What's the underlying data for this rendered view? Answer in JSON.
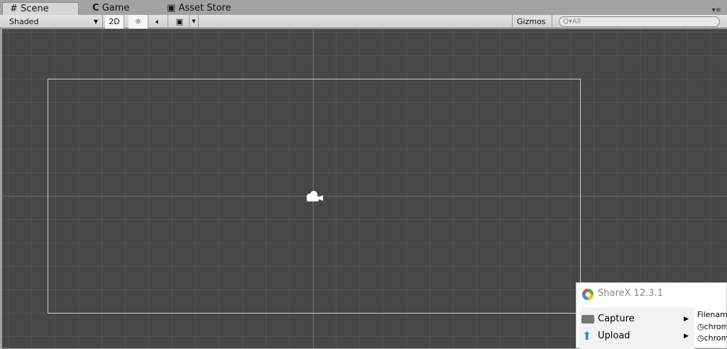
{
  "tabs": [
    {
      "label": "Scene",
      "icon": "grid-icon"
    },
    {
      "label": "Game",
      "icon": "pacman-icon"
    },
    {
      "label": "Asset Store",
      "icon": "bag-icon"
    }
  ],
  "toolbar": {
    "shading": "Shaded",
    "mode_2d": "2D",
    "gizmos": "Gizmos",
    "search_placeholder": "All"
  },
  "sharex": {
    "title": "ShareX 12.3.1",
    "menu": [
      {
        "label": "Capture"
      },
      {
        "label": "Upload"
      }
    ],
    "side_header": "Filename",
    "recent": [
      "chrome",
      "chrome"
    ]
  }
}
